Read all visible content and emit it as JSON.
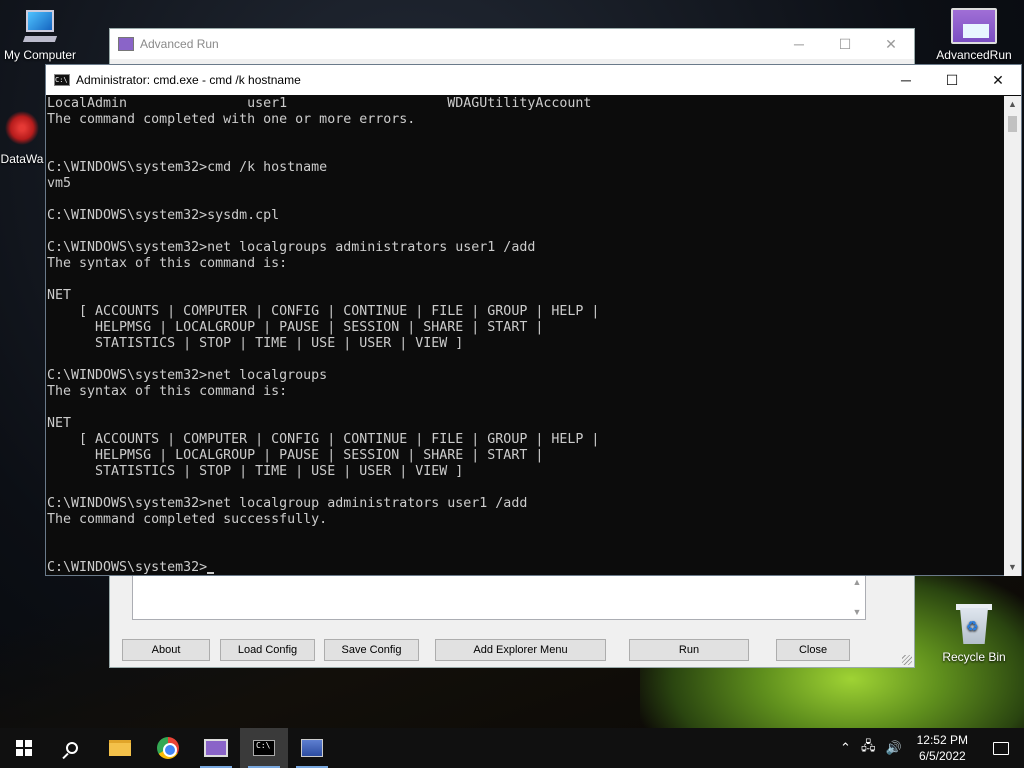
{
  "desktop": {
    "icons": [
      {
        "label": "My Computer"
      },
      {
        "label": "DataWa"
      },
      {
        "label": "AdvancedRun"
      },
      {
        "label": "Recycle Bin"
      }
    ]
  },
  "advanced_run": {
    "title": "Advanced Run",
    "buttons": {
      "about": "About",
      "load_config": "Load Config",
      "save_config": "Save Config",
      "add_explorer_menu": "Add Explorer Menu",
      "run": "Run",
      "close": "Close"
    }
  },
  "cmd": {
    "title": "Administrator: cmd.exe - cmd  /k hostname",
    "icon_text": "C:\\",
    "lines": [
      "LocalAdmin               user1                    WDAGUtilityAccount",
      "The command completed with one or more errors.",
      "",
      "",
      "C:\\WINDOWS\\system32>cmd /k hostname",
      "vm5",
      "",
      "C:\\WINDOWS\\system32>sysdm.cpl",
      "",
      "C:\\WINDOWS\\system32>net localgroups administrators user1 /add",
      "The syntax of this command is:",
      "",
      "NET",
      "    [ ACCOUNTS | COMPUTER | CONFIG | CONTINUE | FILE | GROUP | HELP |",
      "      HELPMSG | LOCALGROUP | PAUSE | SESSION | SHARE | START |",
      "      STATISTICS | STOP | TIME | USE | USER | VIEW ]",
      "",
      "C:\\WINDOWS\\system32>net localgroups",
      "The syntax of this command is:",
      "",
      "NET",
      "    [ ACCOUNTS | COMPUTER | CONFIG | CONTINUE | FILE | GROUP | HELP |",
      "      HELPMSG | LOCALGROUP | PAUSE | SESSION | SHARE | START |",
      "      STATISTICS | STOP | TIME | USE | USER | VIEW ]",
      "",
      "C:\\WINDOWS\\system32>net localgroup administrators user1 /add",
      "The command completed successfully.",
      "",
      ""
    ],
    "prompt": "C:\\WINDOWS\\system32>"
  },
  "taskbar": {
    "apps": [
      "start",
      "search",
      "file-explorer",
      "chrome",
      "advanced-run",
      "cmd",
      "network"
    ],
    "time": "12:52 PM",
    "date": "6/5/2022"
  },
  "colors": {
    "console_bg": "#0c0c0c",
    "console_fg": "#cccccc",
    "taskbar_bg": "#101010"
  }
}
